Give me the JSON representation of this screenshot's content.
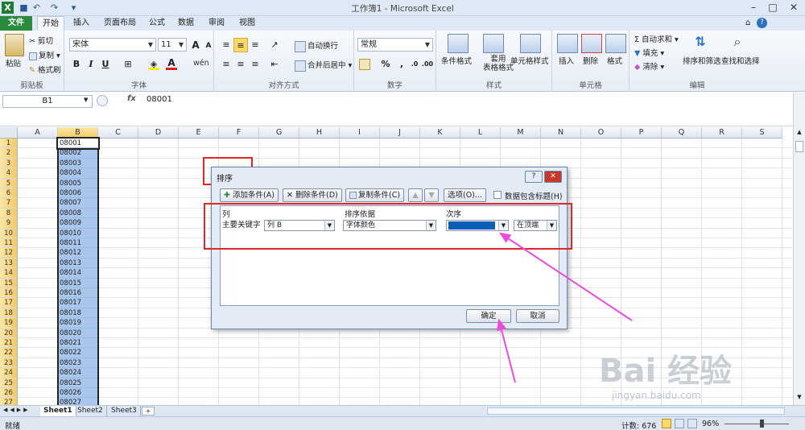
{
  "window": {
    "title": "工作簿1 - Microsoft Excel"
  },
  "quick_access": [
    "excel-logo",
    "save",
    "undo",
    "redo",
    "customize"
  ],
  "tabs": [
    "文件",
    "开始",
    "插入",
    "页面布局",
    "公式",
    "数据",
    "审阅",
    "视图"
  ],
  "ribbon": {
    "clipboard": {
      "paste": "粘贴",
      "cut": "剪切",
      "copy": "复制 ▾",
      "format_painter": "格式刷",
      "label": "剪贴板"
    },
    "font": {
      "name": "宋体",
      "size": "11",
      "bold": "B",
      "italic": "I",
      "underline": "U",
      "phonetic": "wén",
      "label": "字体"
    },
    "alignment": {
      "wrap": "自动换行",
      "merge": "合并后居中 ▾",
      "label": "对齐方式"
    },
    "number": {
      "format": "常规",
      "percent": "%",
      "comma": ",",
      "label": "数字"
    },
    "styles": {
      "conditional": "条件格式",
      "table": "套用\n表格格式",
      "cell": "单元格样式",
      "label": "样式"
    },
    "cells": {
      "insert": "插入",
      "delete": "删除",
      "format": "格式",
      "label": "单元格"
    },
    "editing": {
      "autosum": "Σ 自动求和 ▾",
      "fill": "填充 ▾",
      "clear": "清除 ▾",
      "sort": "排序和筛选",
      "find": "查找和选择",
      "label": "编辑"
    }
  },
  "formula_bar": {
    "name_box": "B1",
    "fx": "fx",
    "formula": "08001"
  },
  "columns": [
    "A",
    "B",
    "C",
    "D",
    "E",
    "F",
    "G",
    "H",
    "I",
    "J",
    "K",
    "L",
    "M",
    "N",
    "O",
    "P",
    "Q",
    "R",
    "S"
  ],
  "selected_column": "B",
  "rows": [
    "1",
    "2",
    "3",
    "4",
    "5",
    "6",
    "7",
    "8",
    "9",
    "10",
    "11",
    "12",
    "13",
    "14",
    "15",
    "16",
    "17",
    "18",
    "19",
    "20",
    "21",
    "22",
    "23",
    "24",
    "25",
    "26",
    "27"
  ],
  "cells_B": [
    "08001",
    "08002",
    "08003",
    "08004",
    "08005",
    "08006",
    "08007",
    "08008",
    "08009",
    "08010",
    "08011",
    "08012",
    "08013",
    "08014",
    "08015",
    "08016",
    "08017",
    "08018",
    "08019",
    "08020",
    "08021",
    "08022",
    "08023",
    "08024",
    "08025",
    "08026",
    "08027"
  ],
  "sheets": [
    "Sheet1",
    "Sheet2",
    "Sheet3"
  ],
  "active_sheet": "Sheet1",
  "status": {
    "ready": "就绪",
    "count": "计数: 676",
    "zoom": "96%"
  },
  "dialog": {
    "title": "排序",
    "help": "?",
    "close": "✕",
    "add_level": "添加条件(A)",
    "delete_level": "删除条件(D)",
    "copy_level": "复制条件(C)",
    "options": "选项(O)...",
    "header_checkbox": "数据包含标题(H)",
    "col_header": "列",
    "sort_on_header": "排序依据",
    "order_header": "次序",
    "row_label": "主要关键字",
    "column_value": "列 B",
    "sort_on_value": "字体颜色",
    "order_color": "#0b5fb4",
    "position_value": "在顶端",
    "ok": "确定",
    "cancel": "取消"
  },
  "watermark": {
    "brand": "Bai  经验",
    "url": "jingyan.baidu.com"
  },
  "annotation_color": "#e84fd9"
}
